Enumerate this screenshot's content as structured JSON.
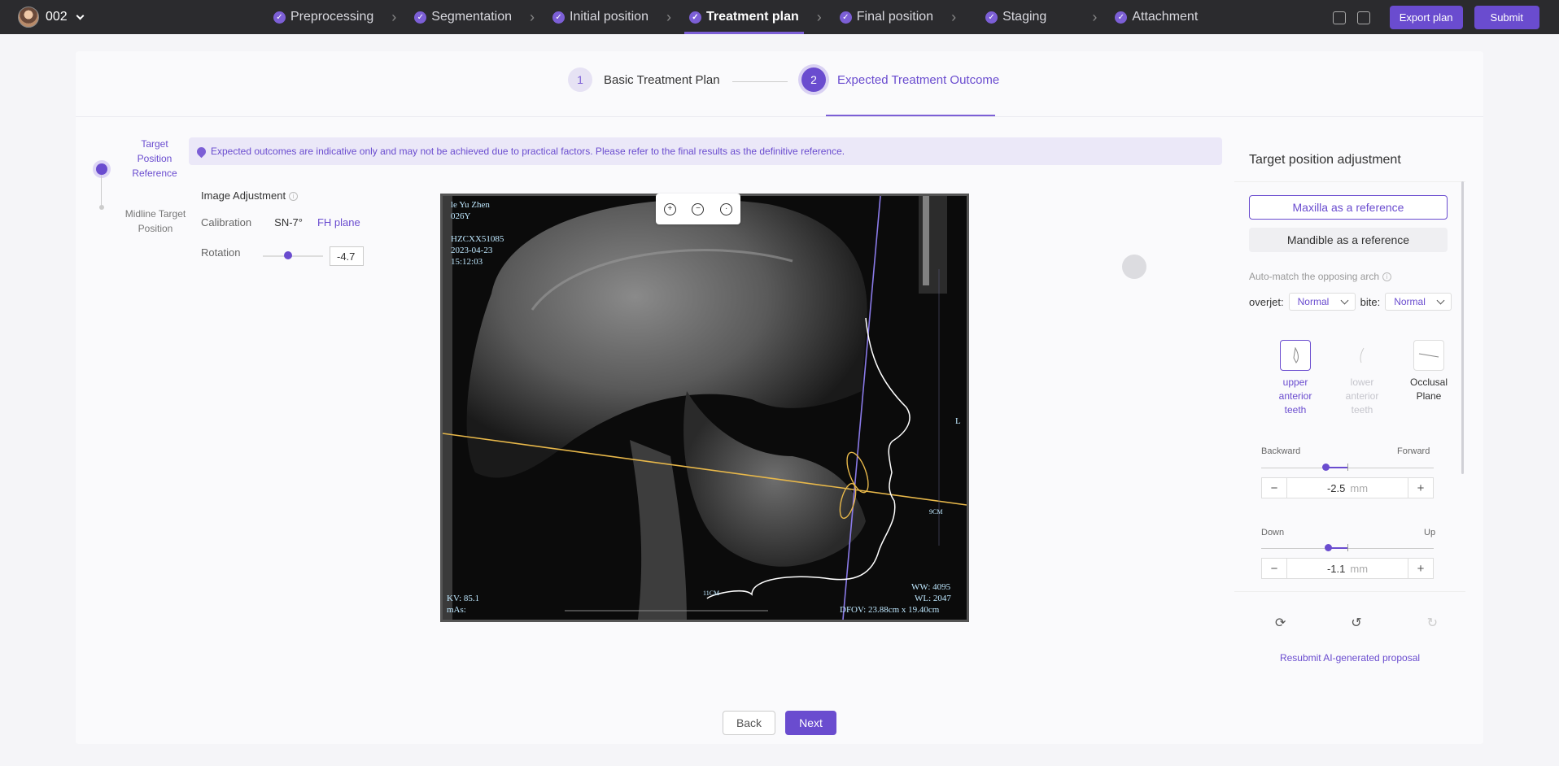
{
  "header": {
    "patient_id": "002",
    "steps": [
      {
        "label": "Preprocessing",
        "active": false
      },
      {
        "label": "Segmentation",
        "active": false
      },
      {
        "label": "Initial position",
        "active": false
      },
      {
        "label": "Treatment plan",
        "active": true
      },
      {
        "label": "Final position",
        "active": false
      },
      {
        "label": "Staging",
        "active": false
      },
      {
        "label": "Attachment",
        "active": false
      }
    ],
    "export_label": "Export plan",
    "submit_label": "Submit"
  },
  "phases": {
    "p1_num": "1",
    "p1_label": "Basic Treatment Plan",
    "p2_num": "2",
    "p2_label": "Expected Treatment Outcome"
  },
  "left_nav": {
    "item1": "Target Position Reference",
    "item2": "Midline Target Position"
  },
  "alert": "Expected outcomes are indicative only and may not be achieved due to practical factors. Please refer to the final results as the definitive reference.",
  "image_adjustment": {
    "title": "Image Adjustment",
    "calibration_label": "Calibration",
    "calibration_value": "SN-7°",
    "calibration_link": "FH plane",
    "rotation_label": "Rotation",
    "rotation_value": "-4.7"
  },
  "xray_text": {
    "name": "le Yu Zhen",
    "age": "026Y",
    "id": "HZCXX51085",
    "date": "2023-04-23",
    "time": "15:12:03",
    "kv": "KV: 85.1",
    "mas": "mAs:",
    "ww": "WW: 4095",
    "wl": "WL: 2047",
    "dfov": "DFOV: 23.88cm x 19.40cm",
    "ruler_a": "11CM",
    "ruler_b": "9CM",
    "side": "L"
  },
  "right_panel": {
    "title": "Target position adjustment",
    "maxilla_ref": "Maxilla as a reference",
    "mandible_ref": "Mandible as a reference",
    "auto_match": "Auto-match the opposing arch",
    "overjet_label": "overjet:",
    "overjet_value": "Normal",
    "bite_label": "bite:",
    "bite_value": "Normal",
    "teeth_upper": "upper anterior teeth",
    "teeth_lower": "lower anterior teeth",
    "teeth_occlusal": "Occlusal Plane",
    "backward": "Backward",
    "forward": "Forward",
    "bf_value": "-2.5",
    "down": "Down",
    "up": "Up",
    "du_value": "-1.1",
    "unit": "mm",
    "minus": "−",
    "plus": "+",
    "resubmit": "Resubmit AI-generated proposal"
  },
  "footer": {
    "back": "Back",
    "next": "Next"
  }
}
